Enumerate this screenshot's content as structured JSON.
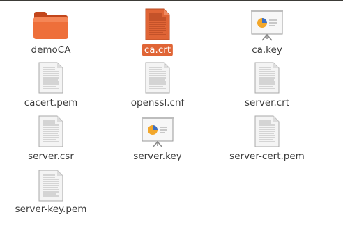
{
  "files": [
    {
      "name": "demoCA",
      "icon": "folder-icon",
      "selected": false
    },
    {
      "name": "ca.crt",
      "icon": "text-file-icon",
      "selected": true
    },
    {
      "name": "ca.key",
      "icon": "presentation-file-icon",
      "selected": false
    },
    {
      "name": "cacert.pem",
      "icon": "text-file-icon",
      "selected": false
    },
    {
      "name": "openssl.cnf",
      "icon": "text-file-icon",
      "selected": false
    },
    {
      "name": "server.crt",
      "icon": "text-file-icon",
      "selected": false
    },
    {
      "name": "server.csr",
      "icon": "text-file-icon",
      "selected": false
    },
    {
      "name": "server.key",
      "icon": "presentation-file-icon",
      "selected": false
    },
    {
      "name": "server-cert.pem",
      "icon": "text-file-icon",
      "selected": false
    },
    {
      "name": "server-key.pem",
      "icon": "text-file-icon",
      "selected": false
    }
  ],
  "colors": {
    "selection": "#e06536",
    "folder": "#e8612c",
    "text": "#3c3c3c"
  }
}
